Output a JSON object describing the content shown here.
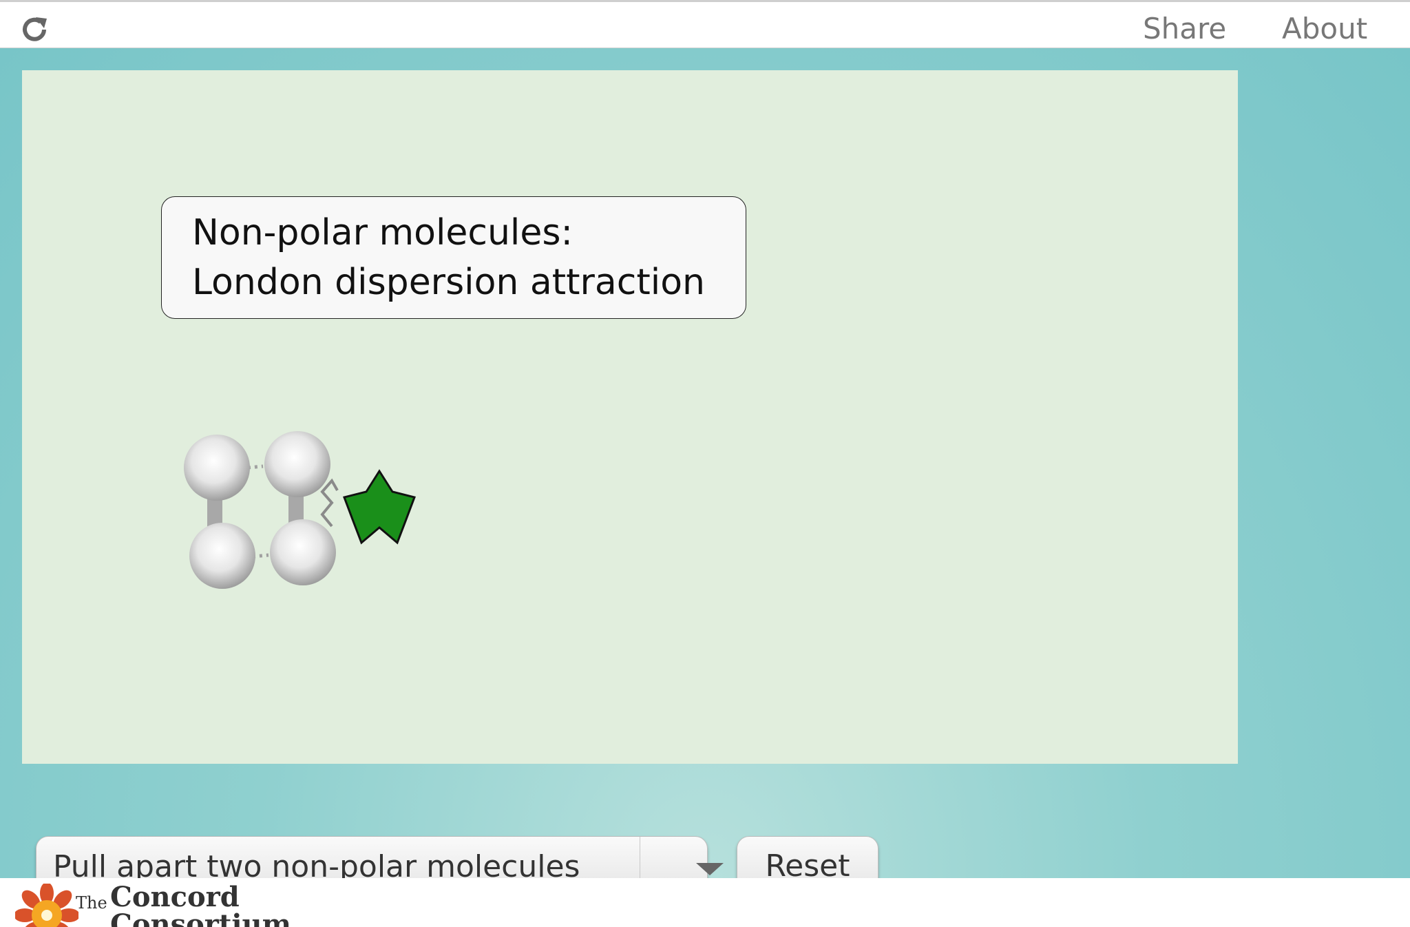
{
  "topbar": {
    "reload_icon": "reload-icon",
    "share_label": "Share",
    "about_label": "About"
  },
  "model": {
    "callout_line1": "Non-polar molecules:",
    "callout_line2": "London dispersion attraction",
    "background_color": "#e1eedd",
    "star_color": "#1a8f1a"
  },
  "controls": {
    "dropdown_selected": "Pull apart two non-polar molecules",
    "reset_label": "Reset"
  },
  "footer": {
    "logo_the": "The",
    "logo_name_line1": "Concord",
    "logo_name_line2": "Consortium"
  }
}
